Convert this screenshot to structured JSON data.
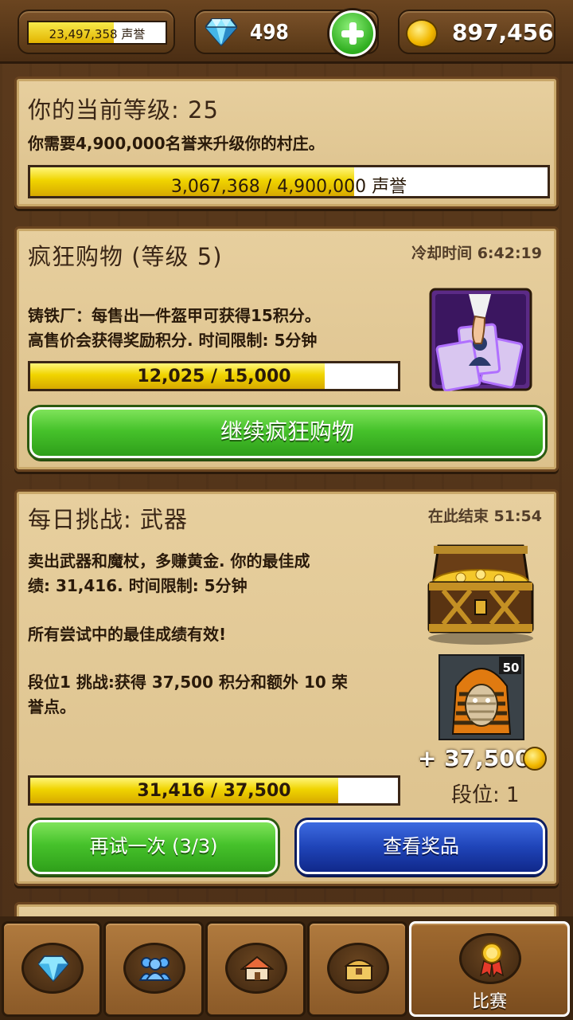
{
  "topbar": {
    "fame_text": "23,497,358",
    "fame_unit": "声誉",
    "fame_fill_fraction": 0.62,
    "gems": "498",
    "gold": "897,456"
  },
  "level_panel": {
    "title": "你的当前等级: 25",
    "desc": "你需要4,900,000名誉来升级你的村庄。",
    "progress_text": "3,067,368 / 4,900,000 声誉",
    "progress_fraction": 0.626
  },
  "shopping_panel": {
    "title": "疯狂购物 (等级 5)",
    "cooldown": "冷却时间 6:42:19",
    "desc_line1": "铸铁厂：每售出一件盔甲可获得15积分。",
    "desc_line2": "高售价会获得奖励积分. 时间限制: 5分钟",
    "progress_text": "12,025 / 15,000",
    "progress_fraction": 0.8017,
    "button": "继续疯狂购物"
  },
  "daily_panel": {
    "title": "每日挑战: 武器",
    "ends": "在此结束 51:54",
    "desc_line1": "卖出武器和魔杖，多赚黄金. 你的最佳成",
    "desc_line2": "绩: 31,416. 时间限制: 5分钟",
    "desc_line3": "所有尝试中的最佳成绩有效!",
    "desc_line4": "段位1 挑战:获得 37,500 积分和额外 10 荣",
    "desc_line5": "誉点。",
    "badge_number": "50",
    "reward": "+ 37,500",
    "tier": "段位: 1",
    "progress_text": "31,416 / 37,500",
    "progress_fraction": 0.8378,
    "retry_button": "再试一次 (3/3)",
    "prizes_button": "查看奖品"
  },
  "nav": {
    "contest_label": "比赛"
  }
}
